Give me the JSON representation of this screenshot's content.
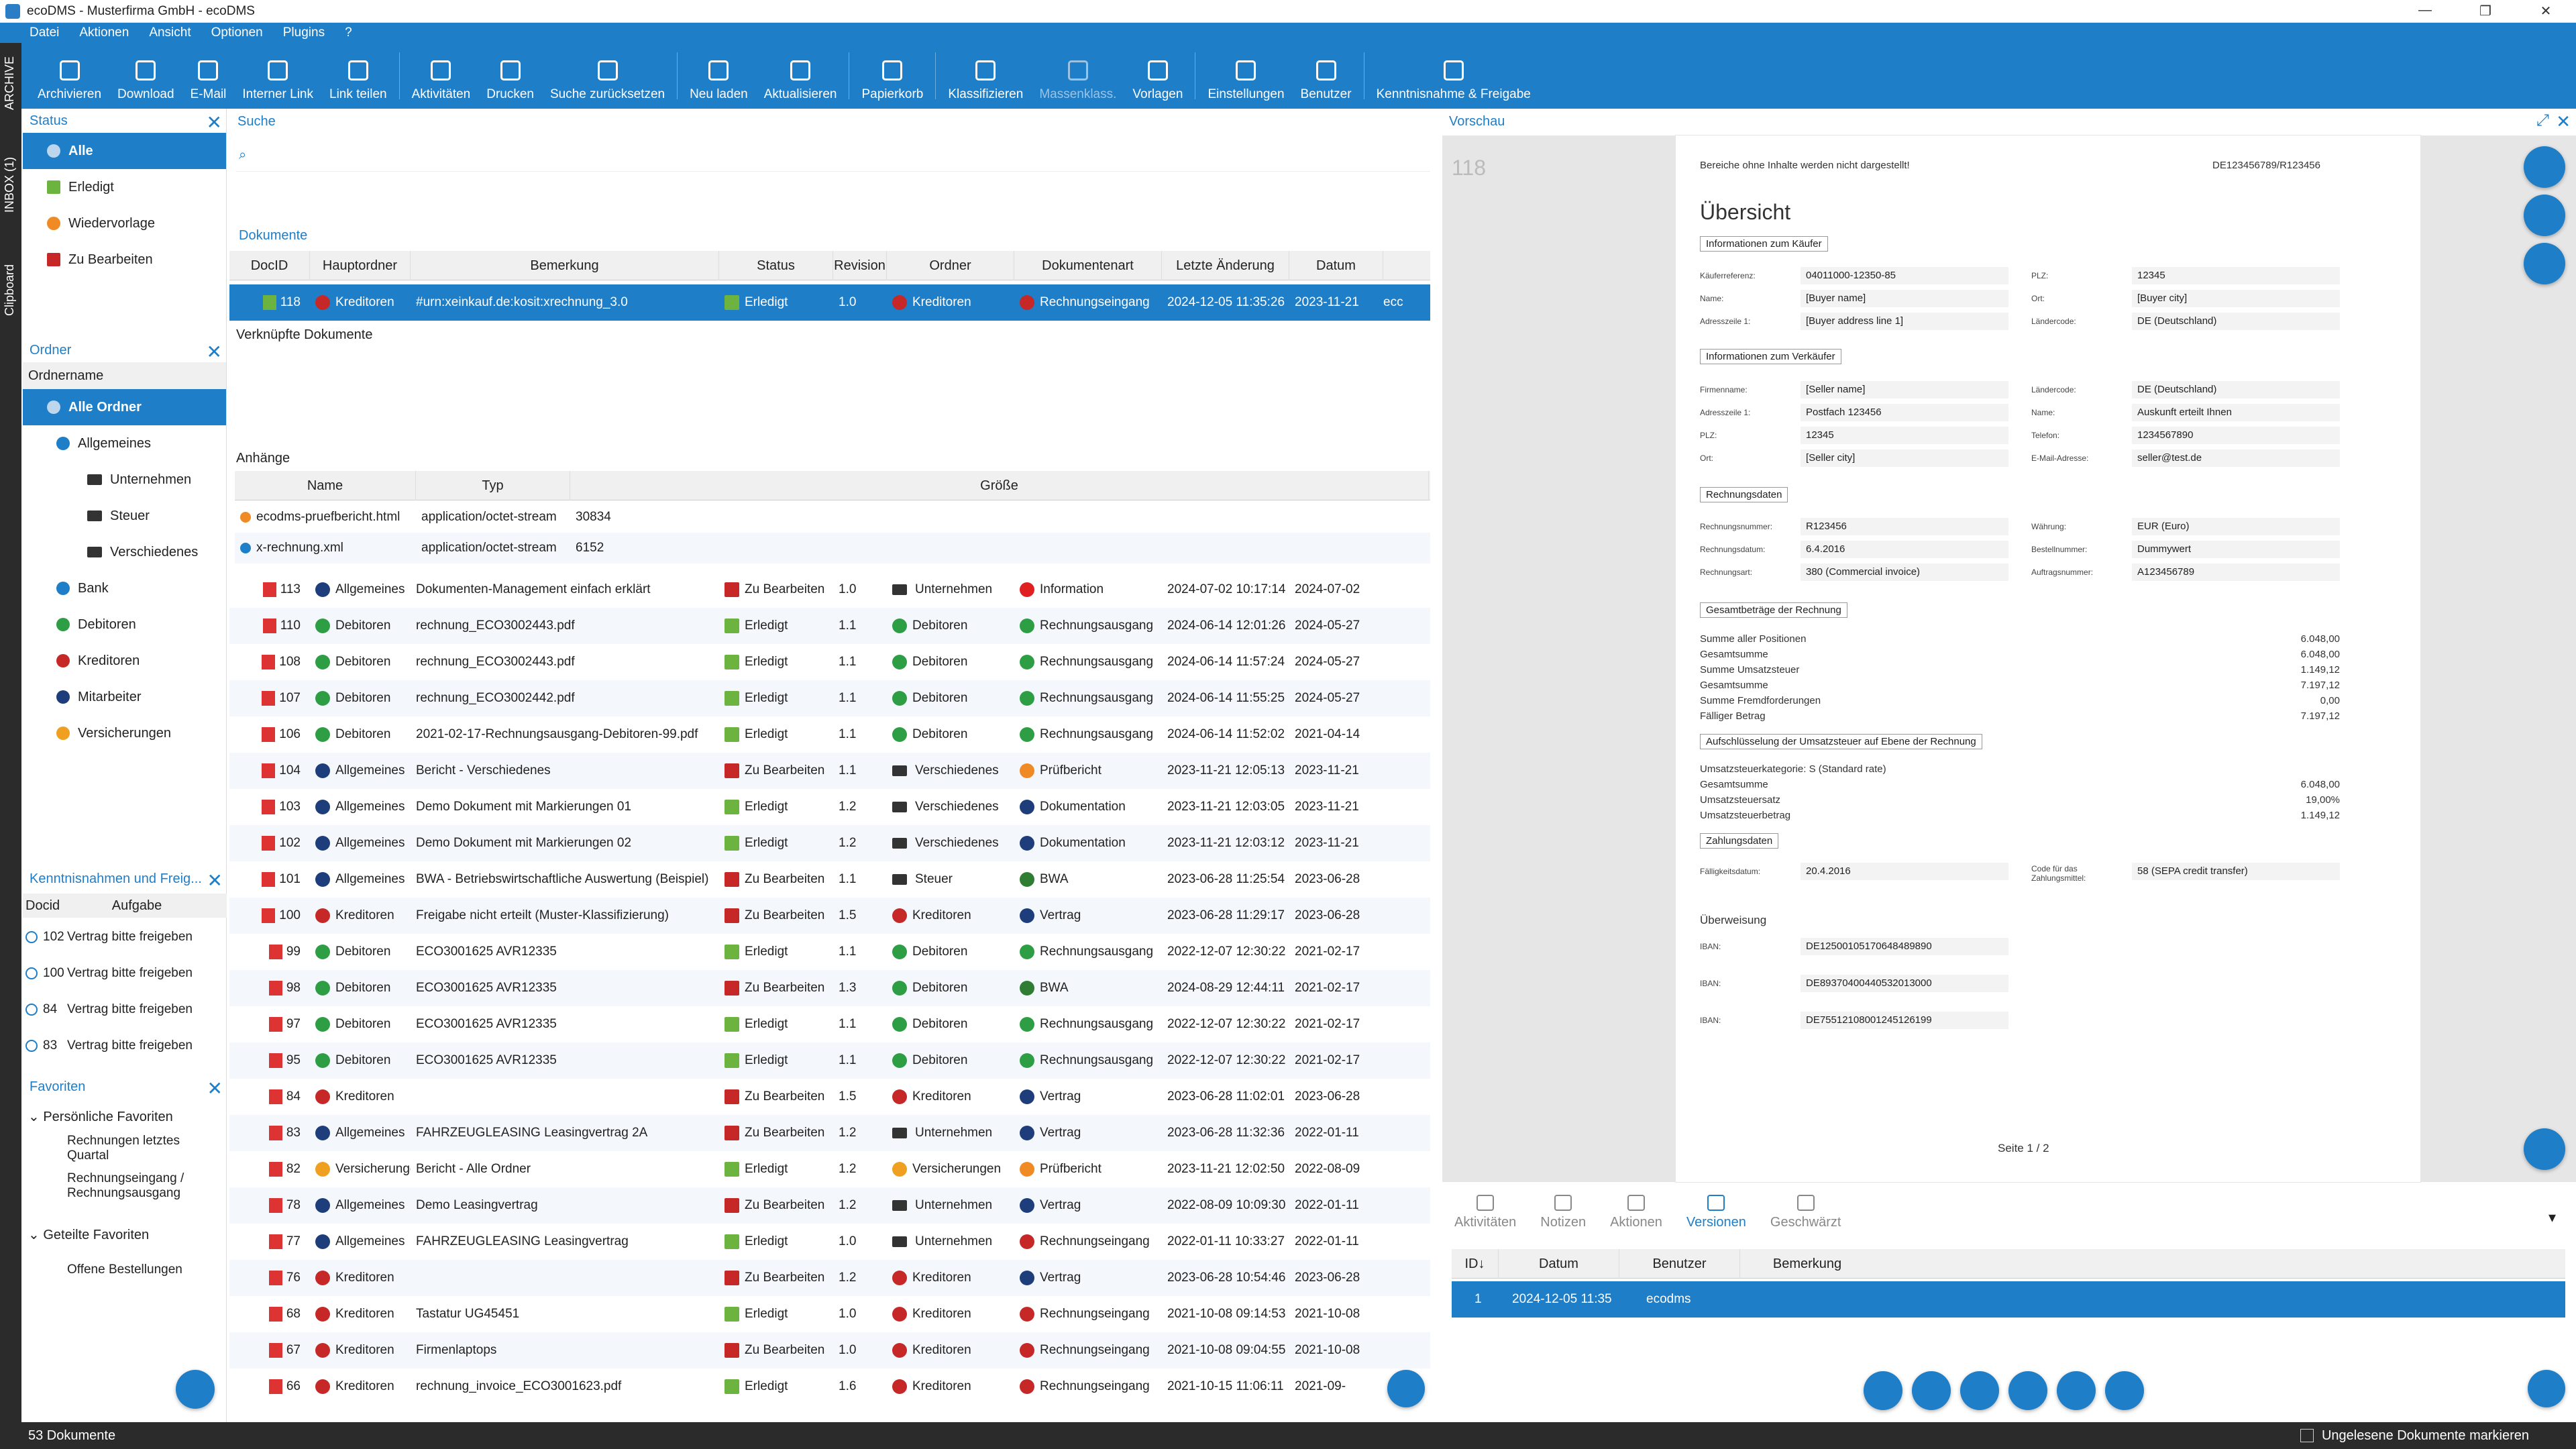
{
  "window": {
    "title": "ecoDMS - Musterfirma GmbH - ecoDMS",
    "min": "—",
    "max": "❐",
    "close": "✕"
  },
  "menu": [
    "Datei",
    "Aktionen",
    "Ansicht",
    "Optionen",
    "Plugins",
    "?"
  ],
  "ribbon": [
    {
      "label": "Archivieren",
      "icon": "archive-icon"
    },
    {
      "label": "Download",
      "icon": "download-icon"
    },
    {
      "label": "E-Mail",
      "icon": "mail-icon"
    },
    {
      "label": "Interner Link",
      "icon": "link-icon"
    },
    {
      "label": "Link teilen",
      "icon": "share-icon"
    },
    {
      "label": "Aktivitäten",
      "icon": "history-icon"
    },
    {
      "label": "Drucken",
      "icon": "print-icon"
    },
    {
      "label": "Suche zurücksetzen",
      "icon": "reset-search-icon"
    },
    {
      "label": "Neu laden",
      "icon": "reload-icon"
    },
    {
      "label": "Aktualisieren",
      "icon": "refresh-icon"
    },
    {
      "label": "Papierkorb",
      "icon": "trash-icon"
    },
    {
      "label": "Klassifizieren",
      "icon": "classify-icon"
    },
    {
      "label": "Massenklass.",
      "icon": "mass-classify-icon",
      "disabled": true
    },
    {
      "label": "Vorlagen",
      "icon": "template-icon"
    },
    {
      "label": "Einstellungen",
      "icon": "settings-icon"
    },
    {
      "label": "Benutzer",
      "icon": "user-icon"
    },
    {
      "label": "Kenntnisnahme & Freigabe",
      "icon": "approval-icon"
    }
  ],
  "lefttabs": [
    "ARCHIVE",
    "INBOX (1)",
    "Clipboard"
  ],
  "status": {
    "title": "Status",
    "items": [
      "Alle",
      "Erledigt",
      "Wiedervorlage",
      "Zu Bearbeiten"
    ]
  },
  "folders": {
    "title": "Ordner",
    "header": "Ordnername",
    "items": [
      {
        "label": "Alle Ordner",
        "level": 0
      },
      {
        "label": "Allgemeines",
        "level": 1
      },
      {
        "label": "Unternehmen",
        "level": 2
      },
      {
        "label": "Steuer",
        "level": 2
      },
      {
        "label": "Verschiedenes",
        "level": 2
      },
      {
        "label": "Bank",
        "level": 1
      },
      {
        "label": "Debitoren",
        "level": 1
      },
      {
        "label": "Kreditoren",
        "level": 1
      },
      {
        "label": "Mitarbeiter",
        "level": 1
      },
      {
        "label": "Versicherungen",
        "level": 1
      }
    ]
  },
  "approvals": {
    "title": "Kenntnisnahmen und Freig...",
    "cols": [
      "Docid",
      "Aufgabe"
    ],
    "rows": [
      {
        "id": "102",
        "task": "Vertrag bitte freigeben"
      },
      {
        "id": "100",
        "task": "Vertrag bitte freigeben"
      },
      {
        "id": "84",
        "task": "Vertrag bitte freigeben"
      },
      {
        "id": "83",
        "task": "Vertrag bitte freigeben"
      }
    ]
  },
  "favorites": {
    "title": "Favoriten",
    "personal": "Persönliche Favoriten",
    "p_items": [
      "Rechnungen letztes Quartal",
      "Rechnungseingang / Rechnungsausgang"
    ],
    "shared": "Geteilte Favoriten",
    "s_items": [
      "Offene Bestellungen"
    ]
  },
  "search": {
    "title": "Suche",
    "placeholder": ""
  },
  "documents": {
    "title": "Dokumente",
    "cols": [
      "DocID",
      "Hauptordner",
      "Bemerkung",
      "Status",
      "Revision",
      "Ordner",
      "Dokumentenart",
      "Letzte Änderung",
      "Datum"
    ],
    "selected": {
      "id": "118",
      "main": "Kreditoren",
      "note": "#urn:xeinkauf.de:kosit:xrechnung_3.0",
      "status": "Erledigt",
      "rev": "1.0",
      "folder": "Kreditoren",
      "type": "Rechnungseingang",
      "changed": "2024-12-05 11:35:26",
      "date": "2023-11-21",
      "extra": "ecc"
    },
    "linked": "Verknüpfte Dokumente",
    "attachments": {
      "title": "Anhänge",
      "cols": [
        "Name",
        "Typ",
        "Größe"
      ],
      "rows": [
        {
          "name": "ecodms-pruefbericht.html",
          "type": "application/octet-stream",
          "size": "30834"
        },
        {
          "name": "x-rechnung.xml",
          "type": "application/octet-stream",
          "size": "6152"
        }
      ]
    },
    "rows": [
      {
        "id": "113",
        "main": "Allgemeines",
        "note": "Dokumenten-Management einfach erklärt",
        "status": "Zu Bearbeiten",
        "rev": "1.0",
        "folder": "Unternehmen",
        "type": "Information",
        "changed": "2024-07-02 10:17:14",
        "date": "2024-07-02"
      },
      {
        "id": "110",
        "main": "Debitoren",
        "note": "rechnung_ECO3002443.pdf",
        "status": "Erledigt",
        "rev": "1.1",
        "folder": "Debitoren",
        "type": "Rechnungsausgang",
        "changed": "2024-06-14 12:01:26",
        "date": "2024-05-27"
      },
      {
        "id": "108",
        "main": "Debitoren",
        "note": "rechnung_ECO3002443.pdf",
        "status": "Erledigt",
        "rev": "1.1",
        "folder": "Debitoren",
        "type": "Rechnungsausgang",
        "changed": "2024-06-14 11:57:24",
        "date": "2024-05-27"
      },
      {
        "id": "107",
        "main": "Debitoren",
        "note": "rechnung_ECO3002442.pdf",
        "status": "Erledigt",
        "rev": "1.1",
        "folder": "Debitoren",
        "type": "Rechnungsausgang",
        "changed": "2024-06-14 11:55:25",
        "date": "2024-05-27"
      },
      {
        "id": "106",
        "main": "Debitoren",
        "note": "2021-02-17-Rechnungsausgang-Debitoren-99.pdf",
        "status": "Erledigt",
        "rev": "1.1",
        "folder": "Debitoren",
        "type": "Rechnungsausgang",
        "changed": "2024-06-14 11:52:02",
        "date": "2021-04-14"
      },
      {
        "id": "104",
        "main": "Allgemeines",
        "note": "Bericht - Verschiedenes",
        "status": "Zu Bearbeiten",
        "rev": "1.1",
        "folder": "Verschiedenes",
        "type": "Prüfbericht",
        "changed": "2023-11-21 12:05:13",
        "date": "2023-11-21"
      },
      {
        "id": "103",
        "main": "Allgemeines",
        "note": "Demo Dokument mit Markierungen 01",
        "status": "Erledigt",
        "rev": "1.2",
        "folder": "Verschiedenes",
        "type": "Dokumentation",
        "changed": "2023-11-21 12:03:05",
        "date": "2023-11-21"
      },
      {
        "id": "102",
        "main": "Allgemeines",
        "note": "Demo Dokument mit Markierungen 02",
        "status": "Erledigt",
        "rev": "1.2",
        "folder": "Verschiedenes",
        "type": "Dokumentation",
        "changed": "2023-11-21 12:03:12",
        "date": "2023-11-21"
      },
      {
        "id": "101",
        "main": "Allgemeines",
        "note": "BWA - Betriebswirtschaftliche Auswertung (Beispiel)",
        "status": "Zu Bearbeiten",
        "rev": "1.1",
        "folder": "Steuer",
        "type": "BWA",
        "changed": "2023-06-28 11:25:54",
        "date": "2023-06-28"
      },
      {
        "id": "100",
        "main": "Kreditoren",
        "note": "Freigabe nicht erteilt (Muster-Klassifizierung)",
        "status": "Zu Bearbeiten",
        "rev": "1.5",
        "folder": "Kreditoren",
        "type": "Vertrag",
        "changed": "2023-06-28 11:29:17",
        "date": "2023-06-28"
      },
      {
        "id": "99",
        "main": "Debitoren",
        "note": "ECO3001625 AVR12335",
        "status": "Erledigt",
        "rev": "1.1",
        "folder": "Debitoren",
        "type": "Rechnungsausgang",
        "changed": "2022-12-07 12:30:22",
        "date": "2021-02-17"
      },
      {
        "id": "98",
        "main": "Debitoren",
        "note": "ECO3001625 AVR12335",
        "status": "Zu Bearbeiten",
        "rev": "1.3",
        "folder": "Debitoren",
        "type": "BWA",
        "changed": "2024-08-29 12:44:11",
        "date": "2021-02-17"
      },
      {
        "id": "97",
        "main": "Debitoren",
        "note": "ECO3001625 AVR12335",
        "status": "Erledigt",
        "rev": "1.1",
        "folder": "Debitoren",
        "type": "Rechnungsausgang",
        "changed": "2022-12-07 12:30:22",
        "date": "2021-02-17"
      },
      {
        "id": "95",
        "main": "Debitoren",
        "note": "ECO3001625 AVR12335",
        "status": "Erledigt",
        "rev": "1.1",
        "folder": "Debitoren",
        "type": "Rechnungsausgang",
        "changed": "2022-12-07 12:30:22",
        "date": "2021-02-17"
      },
      {
        "id": "84",
        "main": "Kreditoren",
        "note": "",
        "status": "Zu Bearbeiten",
        "rev": "1.5",
        "folder": "Kreditoren",
        "type": "Vertrag",
        "changed": "2023-06-28 11:02:01",
        "date": "2023-06-28"
      },
      {
        "id": "83",
        "main": "Allgemeines",
        "note": "FAHRZEUGLEASING Leasingvertrag 2A",
        "status": "Zu Bearbeiten",
        "rev": "1.2",
        "folder": "Unternehmen",
        "type": "Vertrag",
        "changed": "2023-06-28 11:32:36",
        "date": "2022-01-11"
      },
      {
        "id": "82",
        "main": "Versicherungen",
        "note": "Bericht - Alle Ordner",
        "status": "Erledigt",
        "rev": "1.2",
        "folder": "Versicherungen",
        "type": "Prüfbericht",
        "changed": "2023-11-21 12:02:50",
        "date": "2022-08-09"
      },
      {
        "id": "78",
        "main": "Allgemeines",
        "note": "Demo Leasingvertrag",
        "status": "Zu Bearbeiten",
        "rev": "1.2",
        "folder": "Unternehmen",
        "type": "Vertrag",
        "changed": "2022-08-09 10:09:30",
        "date": "2022-01-11"
      },
      {
        "id": "77",
        "main": "Allgemeines",
        "note": "FAHRZEUGLEASING Leasingvertrag",
        "status": "Erledigt",
        "rev": "1.0",
        "folder": "Unternehmen",
        "type": "Rechnungseingang",
        "changed": "2022-01-11 10:33:27",
        "date": "2022-01-11"
      },
      {
        "id": "76",
        "main": "Kreditoren",
        "note": "",
        "status": "Zu Bearbeiten",
        "rev": "1.2",
        "folder": "Kreditoren",
        "type": "Vertrag",
        "changed": "2023-06-28 10:54:46",
        "date": "2023-06-28"
      },
      {
        "id": "68",
        "main": "Kreditoren",
        "note": "Tastatur UG45451",
        "status": "Erledigt",
        "rev": "1.0",
        "folder": "Kreditoren",
        "type": "Rechnungseingang",
        "changed": "2021-10-08 09:14:53",
        "date": "2021-10-08"
      },
      {
        "id": "67",
        "main": "Kreditoren",
        "note": "Firmenlaptops",
        "status": "Zu Bearbeiten",
        "rev": "1.0",
        "folder": "Kreditoren",
        "type": "Rechnungseingang",
        "changed": "2021-10-08 09:04:55",
        "date": "2021-10-08"
      },
      {
        "id": "66",
        "main": "Kreditoren",
        "note": "rechnung_invoice_ECO3001623.pdf",
        "status": "Erledigt",
        "rev": "1.6",
        "folder": "Kreditoren",
        "type": "Rechnungseingang",
        "changed": "2021-10-15 11:06:11",
        "date": "2021-09-"
      }
    ]
  },
  "preview": {
    "title": "Vorschau",
    "pagenum": "118",
    "doc": {
      "notice": "Bereiche ohne Inhalte werden nicht dargestellt!",
      "ref": "DE123456789/R123456",
      "heading": "Übersicht",
      "buyer_title": "Informationen zum Käufer",
      "buyer": [
        [
          "Käuferreferenz:",
          "04011000-12350-85",
          "PLZ:",
          "12345"
        ],
        [
          "Name:",
          "[Buyer name]",
          "Ort:",
          "[Buyer city]"
        ],
        [
          "Adresszeile 1:",
          "[Buyer address line 1]",
          "Ländercode:",
          "DE (Deutschland)"
        ]
      ],
      "seller_title": "Informationen zum Verkäufer",
      "seller": [
        [
          "Firmenname:",
          "[Seller name]",
          "Ländercode:",
          "DE (Deutschland)"
        ],
        [
          "Adresszeile 1:",
          "Postfach 123456",
          "Name:",
          "Auskunft erteilt Ihnen"
        ],
        [
          "PLZ:",
          "12345",
          "Telefon:",
          "1234567890"
        ],
        [
          "Ort:",
          "[Seller city]",
          "E-Mail-Adresse:",
          "seller@test.de"
        ]
      ],
      "inv_title": "Rechnungsdaten",
      "inv": [
        [
          "Rechnungsnummer:",
          "R123456",
          "Währung:",
          "EUR (Euro)"
        ],
        [
          "Rechnungsdatum:",
          "6.4.2016",
          "Bestellnummer:",
          "Dummywert"
        ],
        [
          "Rechnungsart:",
          "380 (Commercial invoice)",
          "Auftragsnummer:",
          "A123456789"
        ]
      ],
      "tot_title": "Gesamtbeträge der Rechnung",
      "tot": [
        [
          "Summe aller Positionen",
          "6.048,00"
        ],
        [
          "Gesamtsumme",
          "6.048,00"
        ],
        [
          "Summe Umsatzsteuer",
          "1.149,12"
        ],
        [
          "Gesamtsumme",
          "7.197,12"
        ],
        [
          "Summe Fremdforderungen",
          "0,00"
        ],
        [
          "Fälliger Betrag",
          "7.197,12"
        ]
      ],
      "vat_title": "Aufschlüsselung der Umsatzsteuer auf Ebene der Rechnung",
      "vat": [
        [
          "Umsatzsteuerkategorie: S (Standard rate)",
          ""
        ],
        [
          "Gesamtsumme",
          "6.048,00"
        ],
        [
          "Umsatzsteuersatz",
          "19,00%"
        ],
        [
          "Umsatzsteuerbetrag",
          "1.149,12"
        ]
      ],
      "pay_title": "Zahlungsdaten",
      "pay": [
        "Fälligkeitsdatum:",
        "20.4.2016",
        "Code für das Zahlungsmittel:",
        "58 (SEPA credit transfer)"
      ],
      "transfer": "Überweisung",
      "ibans": [
        [
          "IBAN:",
          "DE12500105170648489890"
        ],
        [
          "IBAN:",
          "DE89370400440532013000"
        ],
        [
          "IBAN:",
          "DE75512108001245126199"
        ]
      ],
      "page": "Seite 1 / 2"
    },
    "tabs": [
      "Aktivitäten",
      "Notizen",
      "Aktionen",
      "Versionen",
      "Geschwärzt"
    ],
    "versions": {
      "cols": [
        "ID↓",
        "Datum",
        "Benutzer",
        "Bemerkung"
      ],
      "row": {
        "id": "1",
        "date": "2024-12-05 11:35",
        "user": "ecodms",
        "note": ""
      }
    }
  },
  "statusbar": {
    "count": "53 Dokumente",
    "unread": "Ungelesene Dokumente markieren"
  }
}
